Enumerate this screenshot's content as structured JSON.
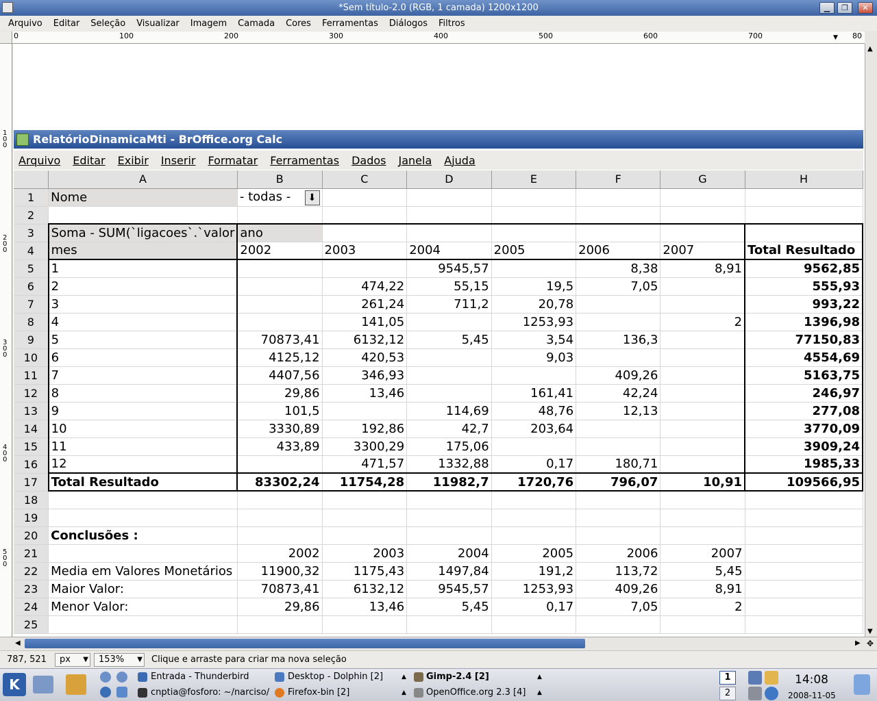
{
  "gimp": {
    "title": "*Sem título-2.0 (RGB, 1 camada) 1200x1200",
    "menu": [
      "Arquivo",
      "Editar",
      "Seleção",
      "Visualizar",
      "Imagem",
      "Camada",
      "Cores",
      "Ferramentas",
      "Diálogos",
      "Filtros"
    ],
    "ruler_h": [
      "0",
      "100",
      "200",
      "300",
      "400",
      "500",
      "600",
      "700",
      "80"
    ],
    "ruler_v": [
      "100",
      "200",
      "300",
      "400",
      "500"
    ],
    "status": {
      "coords": "787, 521",
      "unit": "px",
      "zoom": "153%",
      "message": "Clique e arraste para criar ma nova seleção"
    }
  },
  "calc": {
    "title": "RelatórioDinamicaMti - BrOffice.org Calc",
    "menu": [
      "Arquivo",
      "Editar",
      "Exibir",
      "Inserir",
      "Formatar",
      "Ferramentas",
      "Dados",
      "Janela",
      "Ajuda"
    ],
    "columns": [
      "A",
      "B",
      "C",
      "D",
      "E",
      "F",
      "G",
      "H"
    ],
    "rows": [
      [
        "1",
        "Nome",
        "- todas -",
        "",
        "",
        "",
        "",
        "",
        ""
      ],
      [
        "2",
        "",
        "",
        "",
        "",
        "",
        "",
        "",
        ""
      ],
      [
        "3",
        "Soma - SUM(`ligacoes`.`valor",
        "ano",
        "",
        "",
        "",
        "",
        "",
        ""
      ],
      [
        "4",
        "mes",
        "2002",
        "2003",
        "2004",
        "2005",
        "2006",
        "2007",
        "Total Resultado"
      ],
      [
        "5",
        "1",
        "",
        "",
        "9545,57",
        "",
        "8,38",
        "8,91",
        "9562,85"
      ],
      [
        "6",
        "2",
        "",
        "474,22",
        "55,15",
        "19,5",
        "7,05",
        "",
        "555,93"
      ],
      [
        "7",
        "3",
        "",
        "261,24",
        "711,2",
        "20,78",
        "",
        "",
        "993,22"
      ],
      [
        "8",
        "4",
        "",
        "141,05",
        "",
        "1253,93",
        "",
        "2",
        "1396,98"
      ],
      [
        "9",
        "5",
        "70873,41",
        "6132,12",
        "5,45",
        "3,54",
        "136,3",
        "",
        "77150,83"
      ],
      [
        "10",
        "6",
        "4125,12",
        "420,53",
        "",
        "9,03",
        "",
        "",
        "4554,69"
      ],
      [
        "11",
        "7",
        "4407,56",
        "346,93",
        "",
        "",
        "409,26",
        "",
        "5163,75"
      ],
      [
        "12",
        "8",
        "29,86",
        "13,46",
        "",
        "161,41",
        "42,24",
        "",
        "246,97"
      ],
      [
        "13",
        "9",
        "101,5",
        "",
        "114,69",
        "48,76",
        "12,13",
        "",
        "277,08"
      ],
      [
        "14",
        "10",
        "3330,89",
        "192,86",
        "42,7",
        "203,64",
        "",
        "",
        "3770,09"
      ],
      [
        "15",
        "11",
        "433,89",
        "3300,29",
        "175,06",
        "",
        "",
        "",
        "3909,24"
      ],
      [
        "16",
        "12",
        "",
        "471,57",
        "1332,88",
        "0,17",
        "180,71",
        "",
        "1985,33"
      ],
      [
        "17",
        "Total Resultado",
        "83302,24",
        "11754,28",
        "11982,7",
        "1720,76",
        "796,07",
        "10,91",
        "109566,95"
      ],
      [
        "18",
        "",
        "",
        "",
        "",
        "",
        "",
        "",
        ""
      ],
      [
        "19",
        "",
        "",
        "",
        "",
        "",
        "",
        "",
        ""
      ],
      [
        "20",
        "Conclusões :",
        "",
        "",
        "",
        "",
        "",
        "",
        ""
      ],
      [
        "21",
        "",
        "2002",
        "2003",
        "2004",
        "2005",
        "2006",
        "2007",
        ""
      ],
      [
        "22",
        "Media em Valores Monetários",
        "11900,32",
        "1175,43",
        "1497,84",
        "191,2",
        "113,72",
        "5,45",
        ""
      ],
      [
        "23",
        "Maior Valor:",
        "70873,41",
        "6132,12",
        "9545,57",
        "1253,93",
        "409,26",
        "8,91",
        ""
      ],
      [
        "24",
        "Menor Valor:",
        "29,86",
        "13,46",
        "5,45",
        "0,17",
        "7,05",
        "2",
        ""
      ],
      [
        "25",
        "",
        "",
        "",
        "",
        "",
        "",
        "",
        ""
      ]
    ]
  },
  "taskbar": {
    "tasks": [
      "Entrada - Thunderbird",
      "Desktop - Dolphin [2]",
      "Gimp-2.4 [2]",
      "cnptia@fosforo: ~/narciso/r",
      "Firefox-bin [2]",
      "OpenOffice.org 2.3 [4]"
    ],
    "desktops": [
      "1",
      "2"
    ],
    "time": "14:08",
    "date": "2008-11-05"
  }
}
